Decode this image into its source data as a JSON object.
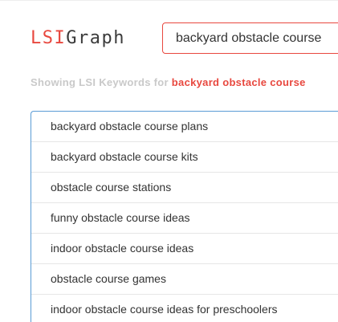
{
  "logo": {
    "lsi": "LSI",
    "graph": "Graph"
  },
  "search": {
    "value": "backyard obstacle course"
  },
  "heading": {
    "prefix": "Showing LSI Keywords for ",
    "keyword": "backyard obstacle course"
  },
  "results": [
    "backyard obstacle course plans",
    "backyard obstacle course kits",
    "obstacle course stations",
    "funny obstacle course ideas",
    "indoor obstacle course ideas",
    "obstacle course games",
    "indoor obstacle course ideas for preschoolers"
  ],
  "colors": {
    "brand": "#e8483f",
    "logo_text": "#3b3b3b",
    "muted": "#c9c9c9",
    "list_border": "#5a9bd5"
  }
}
